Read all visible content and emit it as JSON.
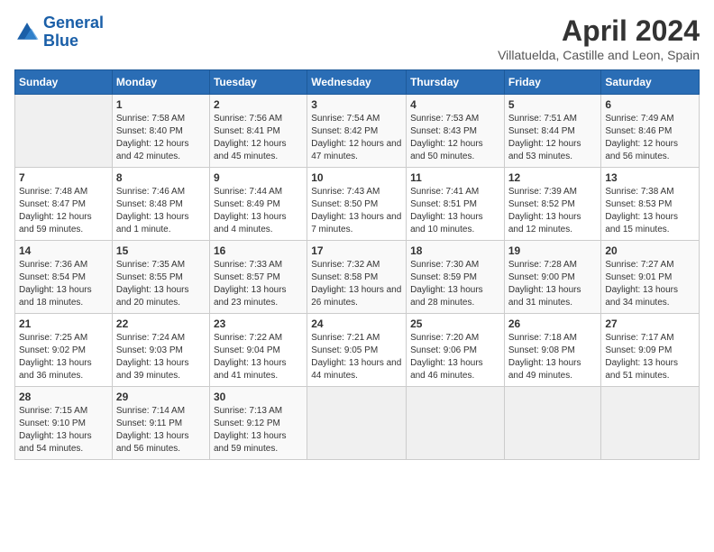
{
  "header": {
    "logo_general": "General",
    "logo_blue": "Blue",
    "month_title": "April 2024",
    "subtitle": "Villatuelda, Castille and Leon, Spain"
  },
  "weekdays": [
    "Sunday",
    "Monday",
    "Tuesday",
    "Wednesday",
    "Thursday",
    "Friday",
    "Saturday"
  ],
  "weeks": [
    [
      {
        "day": "",
        "sunrise": "",
        "sunset": "",
        "daylight": ""
      },
      {
        "day": "1",
        "sunrise": "Sunrise: 7:58 AM",
        "sunset": "Sunset: 8:40 PM",
        "daylight": "Daylight: 12 hours and 42 minutes."
      },
      {
        "day": "2",
        "sunrise": "Sunrise: 7:56 AM",
        "sunset": "Sunset: 8:41 PM",
        "daylight": "Daylight: 12 hours and 45 minutes."
      },
      {
        "day": "3",
        "sunrise": "Sunrise: 7:54 AM",
        "sunset": "Sunset: 8:42 PM",
        "daylight": "Daylight: 12 hours and 47 minutes."
      },
      {
        "day": "4",
        "sunrise": "Sunrise: 7:53 AM",
        "sunset": "Sunset: 8:43 PM",
        "daylight": "Daylight: 12 hours and 50 minutes."
      },
      {
        "day": "5",
        "sunrise": "Sunrise: 7:51 AM",
        "sunset": "Sunset: 8:44 PM",
        "daylight": "Daylight: 12 hours and 53 minutes."
      },
      {
        "day": "6",
        "sunrise": "Sunrise: 7:49 AM",
        "sunset": "Sunset: 8:46 PM",
        "daylight": "Daylight: 12 hours and 56 minutes."
      }
    ],
    [
      {
        "day": "7",
        "sunrise": "Sunrise: 7:48 AM",
        "sunset": "Sunset: 8:47 PM",
        "daylight": "Daylight: 12 hours and 59 minutes."
      },
      {
        "day": "8",
        "sunrise": "Sunrise: 7:46 AM",
        "sunset": "Sunset: 8:48 PM",
        "daylight": "Daylight: 13 hours and 1 minute."
      },
      {
        "day": "9",
        "sunrise": "Sunrise: 7:44 AM",
        "sunset": "Sunset: 8:49 PM",
        "daylight": "Daylight: 13 hours and 4 minutes."
      },
      {
        "day": "10",
        "sunrise": "Sunrise: 7:43 AM",
        "sunset": "Sunset: 8:50 PM",
        "daylight": "Daylight: 13 hours and 7 minutes."
      },
      {
        "day": "11",
        "sunrise": "Sunrise: 7:41 AM",
        "sunset": "Sunset: 8:51 PM",
        "daylight": "Daylight: 13 hours and 10 minutes."
      },
      {
        "day": "12",
        "sunrise": "Sunrise: 7:39 AM",
        "sunset": "Sunset: 8:52 PM",
        "daylight": "Daylight: 13 hours and 12 minutes."
      },
      {
        "day": "13",
        "sunrise": "Sunrise: 7:38 AM",
        "sunset": "Sunset: 8:53 PM",
        "daylight": "Daylight: 13 hours and 15 minutes."
      }
    ],
    [
      {
        "day": "14",
        "sunrise": "Sunrise: 7:36 AM",
        "sunset": "Sunset: 8:54 PM",
        "daylight": "Daylight: 13 hours and 18 minutes."
      },
      {
        "day": "15",
        "sunrise": "Sunrise: 7:35 AM",
        "sunset": "Sunset: 8:55 PM",
        "daylight": "Daylight: 13 hours and 20 minutes."
      },
      {
        "day": "16",
        "sunrise": "Sunrise: 7:33 AM",
        "sunset": "Sunset: 8:57 PM",
        "daylight": "Daylight: 13 hours and 23 minutes."
      },
      {
        "day": "17",
        "sunrise": "Sunrise: 7:32 AM",
        "sunset": "Sunset: 8:58 PM",
        "daylight": "Daylight: 13 hours and 26 minutes."
      },
      {
        "day": "18",
        "sunrise": "Sunrise: 7:30 AM",
        "sunset": "Sunset: 8:59 PM",
        "daylight": "Daylight: 13 hours and 28 minutes."
      },
      {
        "day": "19",
        "sunrise": "Sunrise: 7:28 AM",
        "sunset": "Sunset: 9:00 PM",
        "daylight": "Daylight: 13 hours and 31 minutes."
      },
      {
        "day": "20",
        "sunrise": "Sunrise: 7:27 AM",
        "sunset": "Sunset: 9:01 PM",
        "daylight": "Daylight: 13 hours and 34 minutes."
      }
    ],
    [
      {
        "day": "21",
        "sunrise": "Sunrise: 7:25 AM",
        "sunset": "Sunset: 9:02 PM",
        "daylight": "Daylight: 13 hours and 36 minutes."
      },
      {
        "day": "22",
        "sunrise": "Sunrise: 7:24 AM",
        "sunset": "Sunset: 9:03 PM",
        "daylight": "Daylight: 13 hours and 39 minutes."
      },
      {
        "day": "23",
        "sunrise": "Sunrise: 7:22 AM",
        "sunset": "Sunset: 9:04 PM",
        "daylight": "Daylight: 13 hours and 41 minutes."
      },
      {
        "day": "24",
        "sunrise": "Sunrise: 7:21 AM",
        "sunset": "Sunset: 9:05 PM",
        "daylight": "Daylight: 13 hours and 44 minutes."
      },
      {
        "day": "25",
        "sunrise": "Sunrise: 7:20 AM",
        "sunset": "Sunset: 9:06 PM",
        "daylight": "Daylight: 13 hours and 46 minutes."
      },
      {
        "day": "26",
        "sunrise": "Sunrise: 7:18 AM",
        "sunset": "Sunset: 9:08 PM",
        "daylight": "Daylight: 13 hours and 49 minutes."
      },
      {
        "day": "27",
        "sunrise": "Sunrise: 7:17 AM",
        "sunset": "Sunset: 9:09 PM",
        "daylight": "Daylight: 13 hours and 51 minutes."
      }
    ],
    [
      {
        "day": "28",
        "sunrise": "Sunrise: 7:15 AM",
        "sunset": "Sunset: 9:10 PM",
        "daylight": "Daylight: 13 hours and 54 minutes."
      },
      {
        "day": "29",
        "sunrise": "Sunrise: 7:14 AM",
        "sunset": "Sunset: 9:11 PM",
        "daylight": "Daylight: 13 hours and 56 minutes."
      },
      {
        "day": "30",
        "sunrise": "Sunrise: 7:13 AM",
        "sunset": "Sunset: 9:12 PM",
        "daylight": "Daylight: 13 hours and 59 minutes."
      },
      {
        "day": "",
        "sunrise": "",
        "sunset": "",
        "daylight": ""
      },
      {
        "day": "",
        "sunrise": "",
        "sunset": "",
        "daylight": ""
      },
      {
        "day": "",
        "sunrise": "",
        "sunset": "",
        "daylight": ""
      },
      {
        "day": "",
        "sunrise": "",
        "sunset": "",
        "daylight": ""
      }
    ]
  ]
}
